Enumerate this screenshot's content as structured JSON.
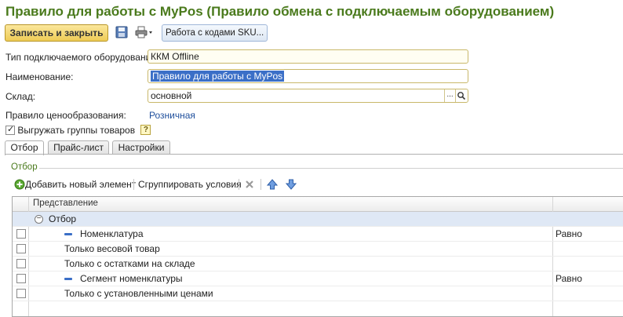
{
  "window": {
    "title": "Правило для работы с MyPos (Правило обмена с подключаемым оборудованием)"
  },
  "toolbar": {
    "save_close_label": "Записать и закрыть",
    "sku_button_label": "Работа с кодами SKU..."
  },
  "form": {
    "equipment_type_label": "Тип подключаемого оборудования:",
    "equipment_type_value": "ККМ Offline",
    "name_label": "Наименование:",
    "name_value": "Правило для работы с MyPos",
    "warehouse_label": "Склад:",
    "warehouse_value": "основной",
    "select_button_label": "...",
    "pricing_rule_label": "Правило ценообразования:",
    "pricing_rule_value": "Розничная",
    "export_groups_label": "Выгружать группы товаров",
    "export_groups_checked": true,
    "help_label": "?"
  },
  "tabs": [
    {
      "label": "Отбор",
      "active": true
    },
    {
      "label": "Прайс-лист",
      "active": false
    },
    {
      "label": "Настройки",
      "active": false
    }
  ],
  "filter": {
    "group_title": "Отбор",
    "commands": {
      "add_label": "Добавить новый элемент",
      "group_label": "Сгруппировать условия"
    },
    "grid": {
      "column_header": "Представление",
      "root_label": "Отбор",
      "rows": [
        {
          "label": "Номенклатура",
          "condition": "Равно",
          "type": "field"
        },
        {
          "label": "Только весовой товар",
          "condition": "",
          "type": "flag"
        },
        {
          "label": "Только с остатками на складе",
          "condition": "",
          "type": "flag"
        },
        {
          "label": "Сегмент номенклатуры",
          "condition": "Равно",
          "type": "field"
        },
        {
          "label": "Только с установленными ценами",
          "condition": "",
          "type": "flag"
        }
      ]
    }
  },
  "colors": {
    "title": "#4a7a1c",
    "link": "#1f4f9c",
    "accent": "#3b6fc7",
    "primary_button": "#eecb55"
  }
}
